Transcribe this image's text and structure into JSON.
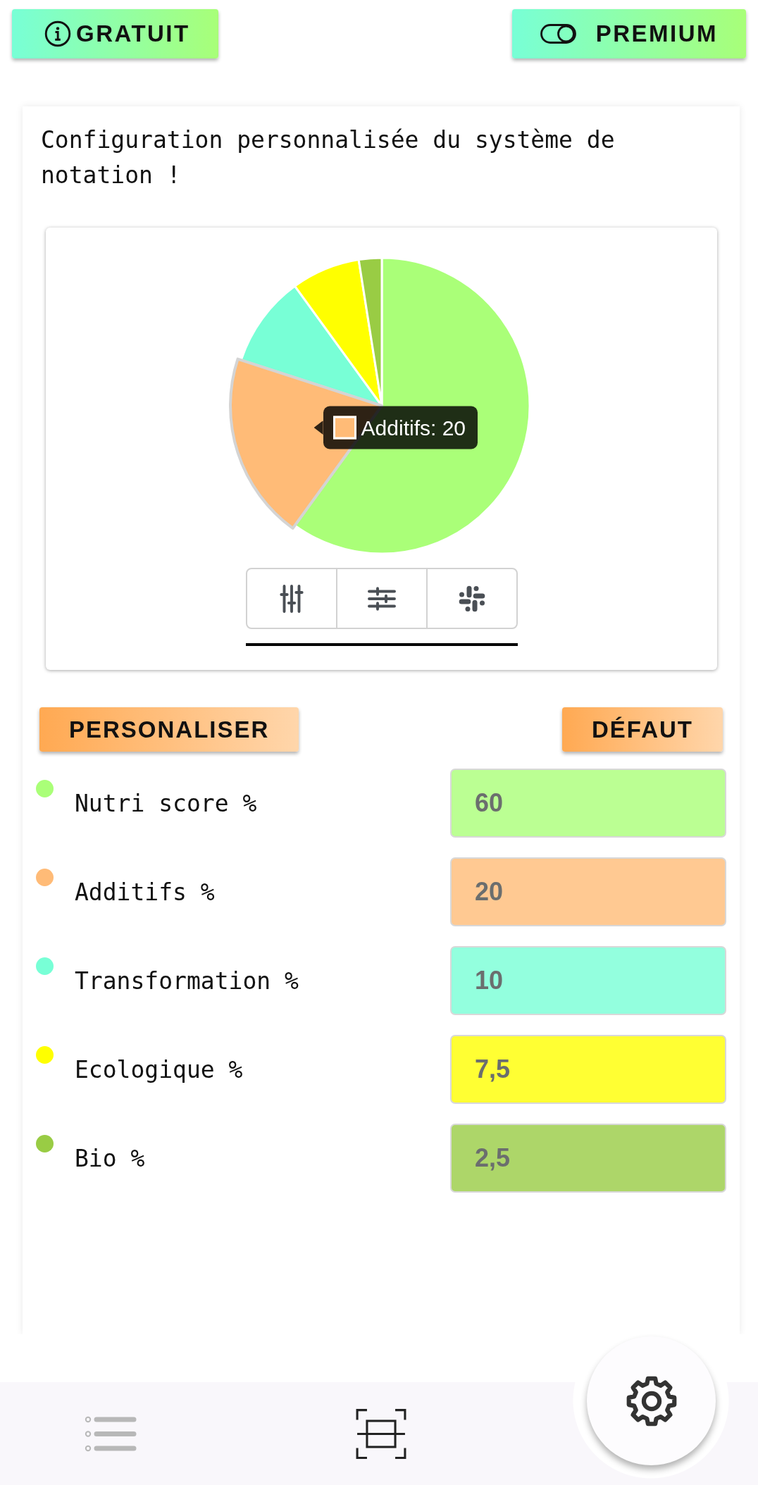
{
  "header_buttons": [
    {
      "label": "GRATUIT",
      "kind": "info"
    },
    {
      "label": "PREMIUM",
      "kind": "toggle"
    }
  ],
  "card": {
    "title": "Configuration personnalisée du système de notation !",
    "chart": {
      "chart_data": {
        "type": "pie",
        "values": [
          60,
          20,
          10,
          7.5,
          2.5
        ]
      },
      "tooltip": {
        "text": "Additifs: 20"
      },
      "view_buttons": [
        {
          "kind": "vertical-sliders"
        },
        {
          "kind": "horizontal-sliders"
        },
        {
          "kind": "pinwheel"
        }
      ]
    },
    "actions": [
      "PERSONALISER",
      "DÉFAUT"
    ],
    "criteria": [
      {
        "label": "Nutri score %",
        "value": "60",
        "color": "#aaff78",
        "hovered": false
      },
      {
        "label": "Additifs %",
        "value": "20",
        "color": "#ffbb77",
        "hovered": true
      },
      {
        "label": "Transformation %",
        "value": "10",
        "color": "#78ffd6",
        "hovered": false
      },
      {
        "label": "Ecologique %",
        "value": "7,5",
        "color": "#ffff00",
        "hovered": false
      },
      {
        "label": "Bio %",
        "value": "2,5",
        "color": "#99cc44",
        "hovered": false
      }
    ]
  },
  "bottom_nav": {
    "items": [
      {
        "kind": "list"
      },
      {
        "kind": "scan"
      }
    ],
    "fab": {
      "kind": "settings"
    }
  }
}
